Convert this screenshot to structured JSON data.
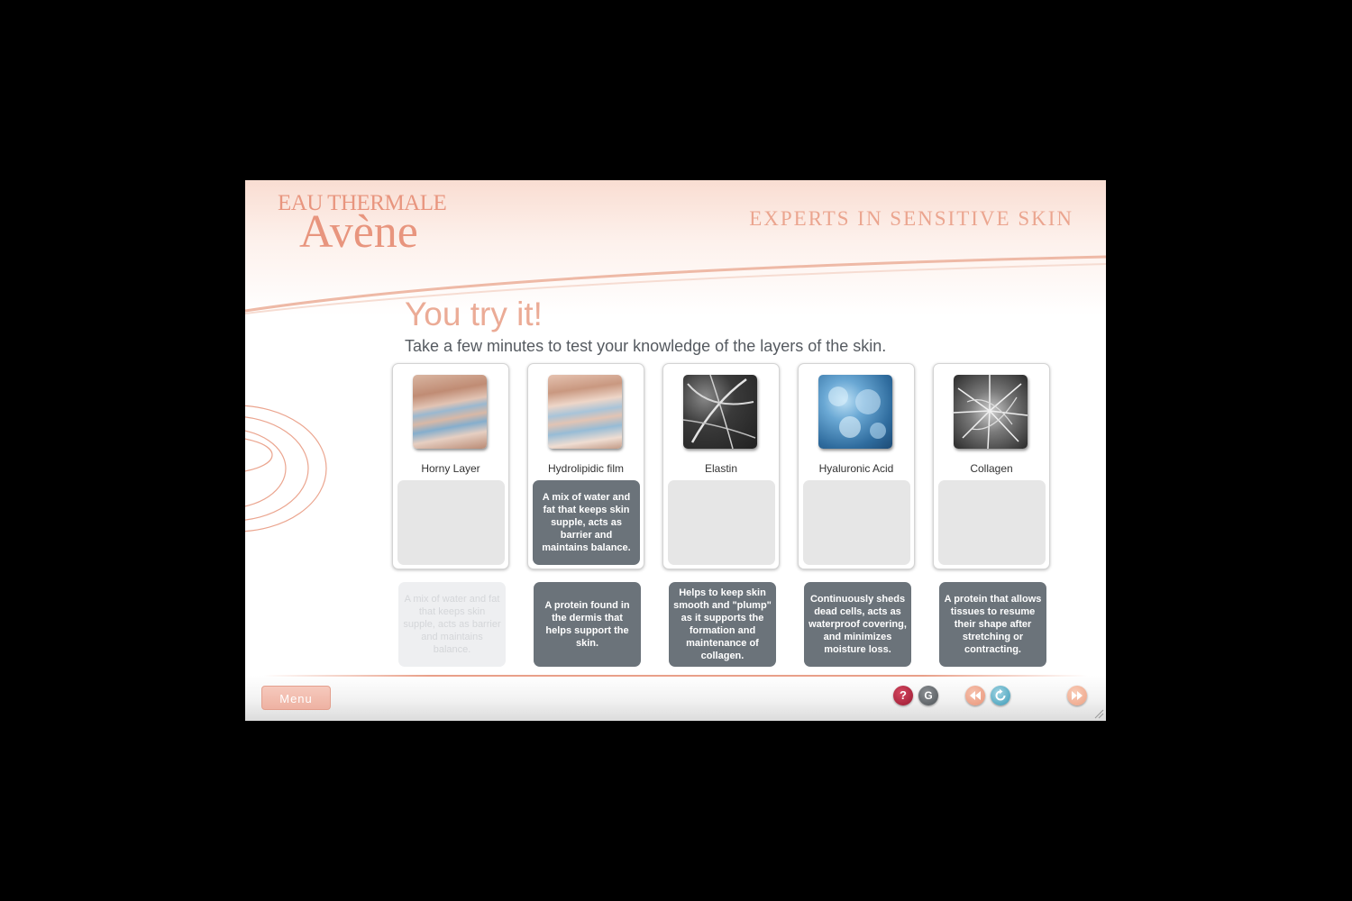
{
  "brand": {
    "logo_top": "EAU THERMALE",
    "logo_main": "Avène",
    "tagline": "EXPERTS IN SENSITIVE SKIN"
  },
  "main": {
    "title": "You try it!",
    "subtitle": "Take a few minutes to test your knowledge of the layers of the skin."
  },
  "cards": [
    {
      "label": "Horny Layer",
      "image": "horny-layer-image",
      "answer": ""
    },
    {
      "label": "Hydrolipidic film",
      "image": "hydrolipidic-film-image",
      "answer": "A mix of water and fat that keeps skin supple, acts as barrier and maintains balance."
    },
    {
      "label": "Elastin",
      "image": "elastin-image",
      "answer": ""
    },
    {
      "label": "Hyaluronic Acid",
      "image": "hyaluronic-acid-image",
      "answer": ""
    },
    {
      "label": "Collagen",
      "image": "collagen-image",
      "answer": ""
    }
  ],
  "definitions": [
    {
      "text": "A mix of water and fat that keeps skin supple, acts as barrier and maintains balance.",
      "used": true
    },
    {
      "text": "A protein found in the dermis that helps support the skin.",
      "used": false
    },
    {
      "text": "Helps to keep skin smooth and \"plump\" as it supports the formation and maintenance of collagen.",
      "used": false
    },
    {
      "text": "Continuously sheds dead cells, acts as waterproof covering, and minimizes moisture loss.",
      "used": false
    },
    {
      "text": "A protein that allows tissues to resume their shape after stretching or contracting.",
      "used": false
    }
  ],
  "footer": {
    "menu_label": "Menu",
    "help_label": "?",
    "glossary_label": "G"
  },
  "colors": {
    "accent": "#e8957e",
    "title": "#ebab96",
    "tile_dark": "#6b737a",
    "tile_empty": "#e6e6e6",
    "help": "#b2223a",
    "replay": "#3b9ab6"
  }
}
